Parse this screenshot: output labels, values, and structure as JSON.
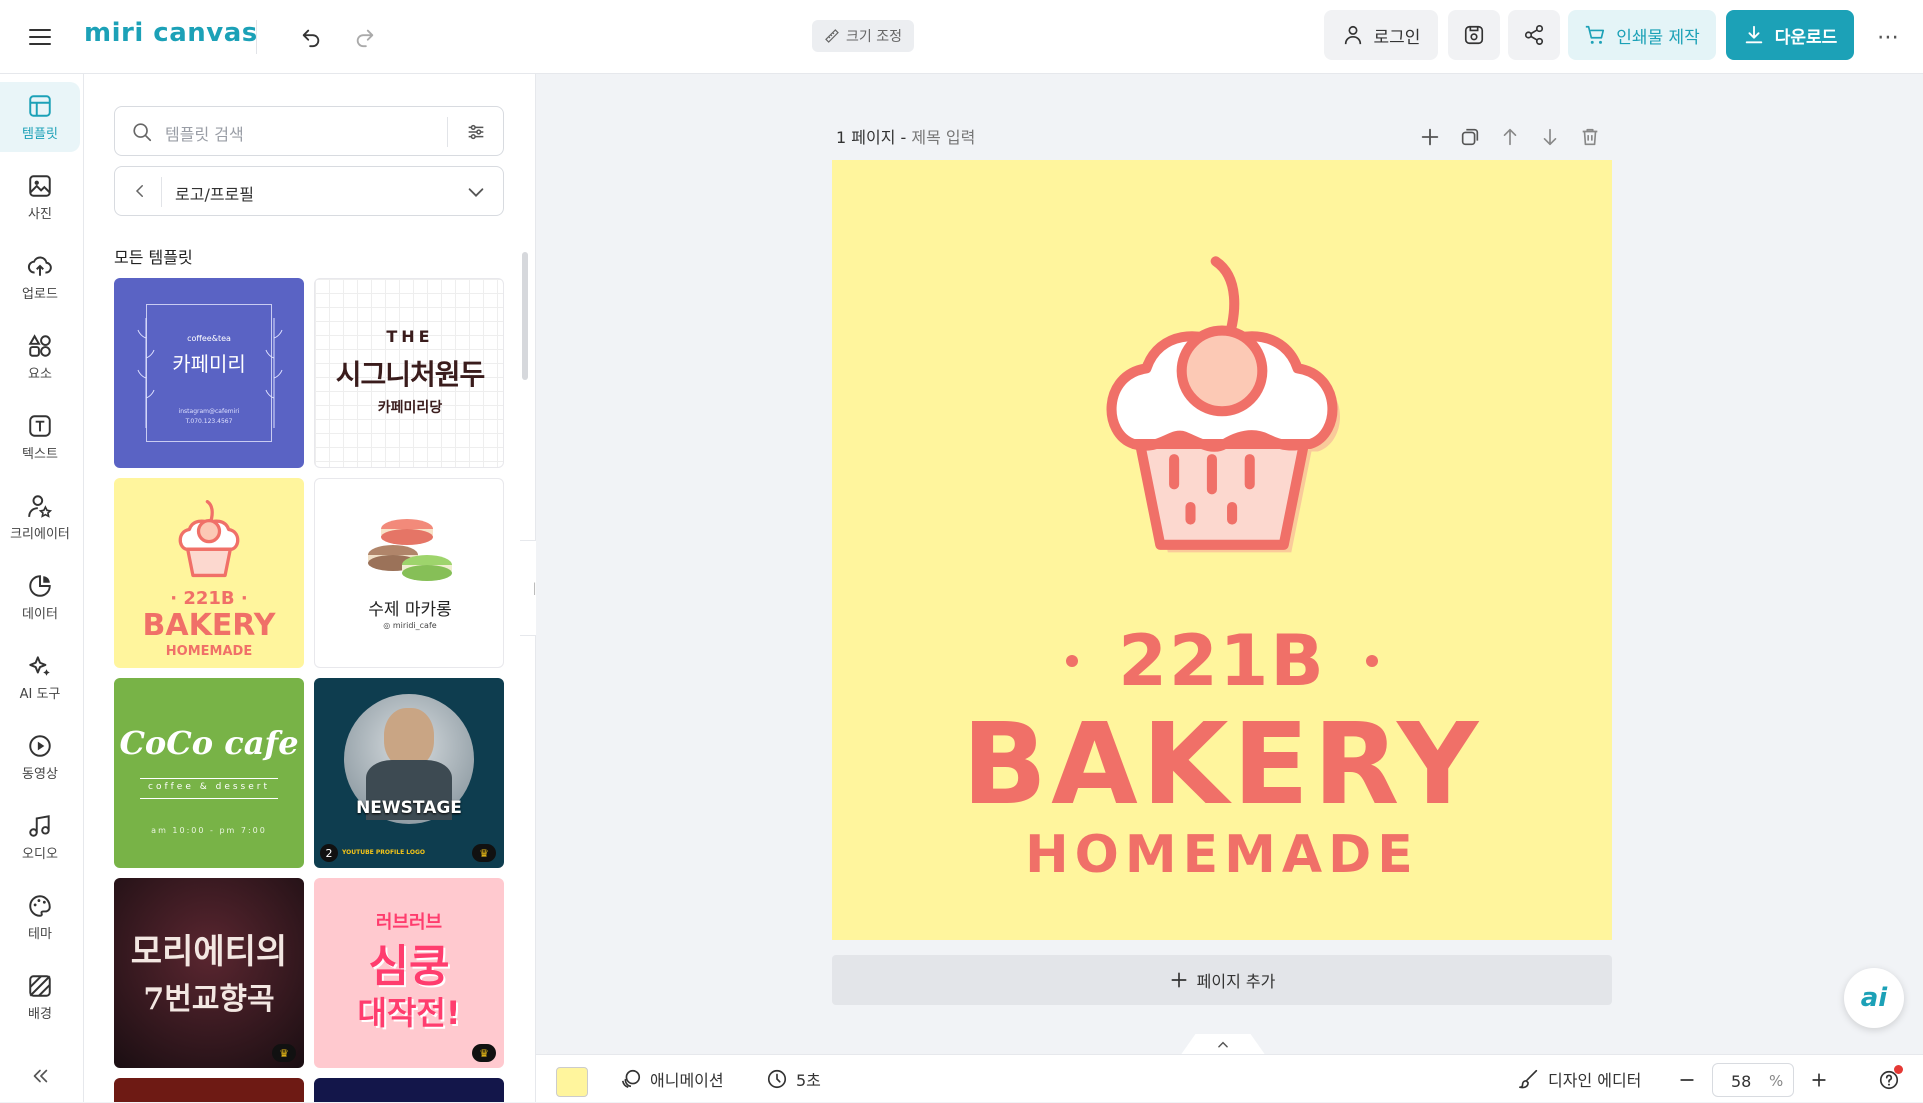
{
  "header": {
    "logo": "miri canvas",
    "resize_label": "크기 조정",
    "login_label": "로그인",
    "print_label": "인쇄물 제작",
    "download_label": "다운로드"
  },
  "sidebar": {
    "items": [
      {
        "label": "템플릿",
        "icon": "template-icon"
      },
      {
        "label": "사진",
        "icon": "photo-icon"
      },
      {
        "label": "업로드",
        "icon": "upload-icon"
      },
      {
        "label": "요소",
        "icon": "elements-icon"
      },
      {
        "label": "텍스트",
        "icon": "text-icon"
      },
      {
        "label": "크리에이터",
        "icon": "creator-icon"
      },
      {
        "label": "데이터",
        "icon": "data-icon"
      },
      {
        "label": "AI 도구",
        "icon": "ai-tools-icon"
      },
      {
        "label": "동영상",
        "icon": "video-icon"
      },
      {
        "label": "오디오",
        "icon": "audio-icon"
      },
      {
        "label": "테마",
        "icon": "theme-icon"
      },
      {
        "label": "배경",
        "icon": "background-icon"
      }
    ]
  },
  "panel": {
    "search_placeholder": "템플릿 검색",
    "category": "로고/프로필",
    "section_title": "모든 템플릿",
    "templates": {
      "t1": {
        "small": "coffee&tea",
        "title": "카페미리",
        "info1": "instagram@cafemiri",
        "info2": "T.070.123.4567"
      },
      "t2": {
        "line1": "THE",
        "line2": "시그니처원두",
        "line3": "카페미리당"
      },
      "t3": {
        "line1": "· 221B ·",
        "line2": "BAKERY",
        "line3": "HOMEMADE"
      },
      "t4": {
        "title": "수제 마카롱",
        "handle": "miridi_cafe"
      },
      "t5": {
        "title": "CoCo cafe",
        "sub": "coffee & dessert",
        "hours": "am 10:00 - pm 7:00"
      },
      "t6": {
        "title": "NEWSTAGE",
        "badge": "2",
        "caption": "YOUTUBE PROFILE LOGO"
      },
      "t7": {
        "title": "모리에티의",
        "sub": "7번교향곡"
      },
      "t8": {
        "small": "러브러브",
        "title": "심쿵",
        "sub": "대작전!"
      }
    }
  },
  "page": {
    "page_number": "1 페이지",
    "separator": " - ",
    "title_placeholder": "제목 입력",
    "add_page_label": "페이지 추가"
  },
  "design": {
    "line1": "221B",
    "line2": "BAKERY",
    "line3": "HOMEMADE",
    "background_color": "#fff59d",
    "accent_color": "#f07068"
  },
  "bottom": {
    "animation_label": "애니메이션",
    "duration_label": "5초",
    "design_editor_label": "디자인 에디터",
    "zoom_value": "58",
    "zoom_unit": "%"
  }
}
